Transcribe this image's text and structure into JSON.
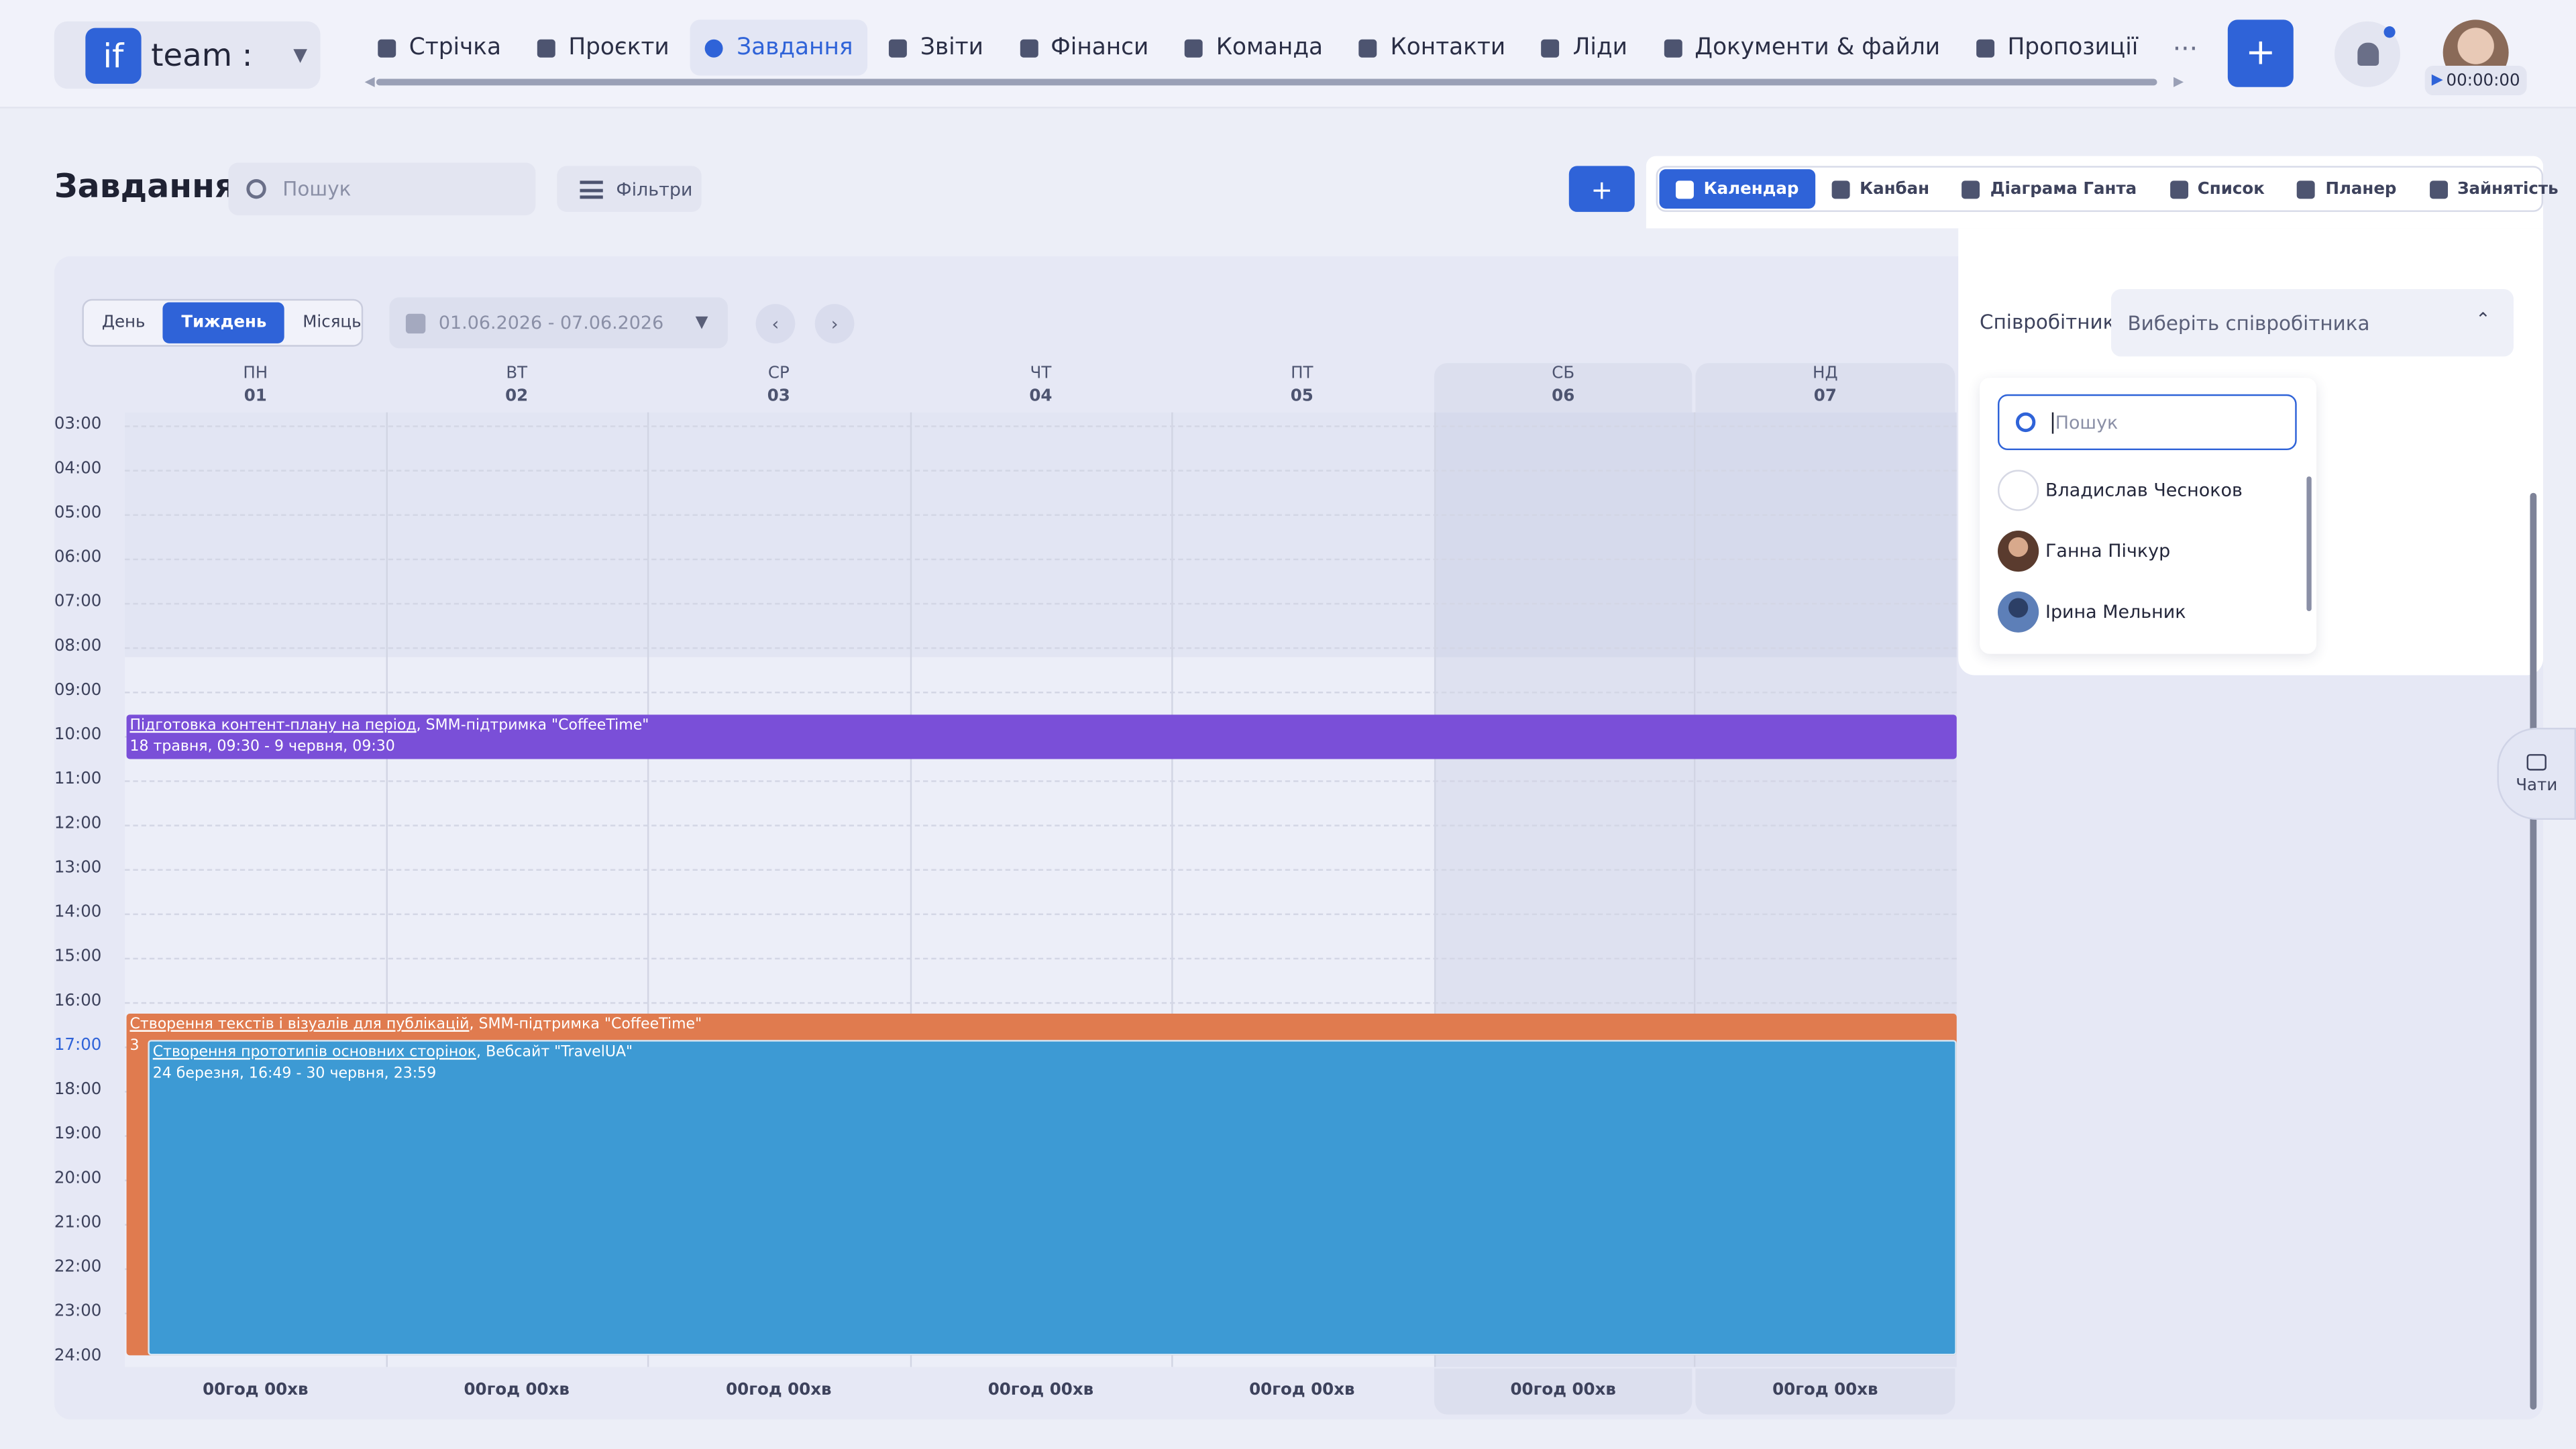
{
  "brand": {
    "logo": "if",
    "name": "team :"
  },
  "nav": {
    "items": [
      {
        "label": "Стрічка",
        "icon": "home-icon"
      },
      {
        "label": "Проєкти",
        "icon": "file-icon"
      },
      {
        "label": "Завдання",
        "icon": "check-circle-icon",
        "active": true
      },
      {
        "label": "Звіти",
        "icon": "report-icon"
      },
      {
        "label": "Фінанси",
        "icon": "wallet-icon"
      },
      {
        "label": "Команда",
        "icon": "user-icon"
      },
      {
        "label": "Контакти",
        "icon": "contacts-icon"
      },
      {
        "label": "Ліди",
        "icon": "link-icon"
      },
      {
        "label": "Документи & файли",
        "icon": "folder-icon"
      },
      {
        "label": "Пропозиції",
        "icon": "document-icon"
      }
    ],
    "more": "···"
  },
  "header": {
    "add": "+",
    "timer": "00:00:00"
  },
  "page": {
    "title": "Завдання",
    "search_placeholder": "Пошук",
    "filters": "Фільтри",
    "add": "+"
  },
  "views": [
    {
      "label": "Календар",
      "active": true
    },
    {
      "label": "Канбан"
    },
    {
      "label": "Діаграма Ганта"
    },
    {
      "label": "Список"
    },
    {
      "label": "Планер"
    },
    {
      "label": "Зайнятість"
    }
  ],
  "calendar": {
    "modes": [
      "День",
      "Тиждень",
      "Місяць"
    ],
    "active_mode": "Тиждень",
    "date_range": "01.06.2026 - 07.06.2026",
    "days": [
      {
        "dw": "ПН",
        "dn": "01"
      },
      {
        "dw": "ВТ",
        "dn": "02"
      },
      {
        "dw": "СР",
        "dn": "03"
      },
      {
        "dw": "ЧТ",
        "dn": "04"
      },
      {
        "dw": "ПТ",
        "dn": "05"
      },
      {
        "dw": "СБ",
        "dn": "06"
      },
      {
        "dw": "НД",
        "dn": "07"
      }
    ],
    "hours": [
      "03:00",
      "04:00",
      "05:00",
      "06:00",
      "07:00",
      "08:00",
      "09:00",
      "10:00",
      "11:00",
      "12:00",
      "13:00",
      "14:00",
      "15:00",
      "16:00",
      "17:00",
      "18:00",
      "19:00",
      "20:00",
      "21:00",
      "22:00",
      "23:00",
      "24:00"
    ],
    "current_hour": "17:00",
    "events": [
      {
        "title": "Підготовка контент-плану на період",
        "project": "SMM-підтримка \"CoffeeTime\"",
        "time": "18 травня, 09:30 - 9 червня, 09:30",
        "color": "#7a4fd8"
      },
      {
        "title": "Створення текстів і візуалів для публікацій",
        "project": "SMM-підтримка \"CoffeeTime\"",
        "time": "3",
        "color": "#e07b4f"
      },
      {
        "title": "Створення прототипів основних сторінок",
        "project": "Вебсайт \"TravelUA\"",
        "time": "24 березня, 16:49 - 30 червня, 23:59",
        "color": "#3d9ad4"
      }
    ],
    "totals": [
      "00год 00хв",
      "00год 00хв",
      "00год 00хв",
      "00год 00хв",
      "00год 00хв",
      "00год 00хв",
      "00год 00хв"
    ]
  },
  "employee": {
    "label": "Співробітник",
    "placeholder": "Виберіть співробітника",
    "search_placeholder": "Пошук",
    "options": [
      {
        "name": "Владислав Чесноков"
      },
      {
        "name": "Ганна Пічкур"
      },
      {
        "name": "Ірина Мельник"
      }
    ]
  },
  "chats": {
    "label": "Чати"
  }
}
